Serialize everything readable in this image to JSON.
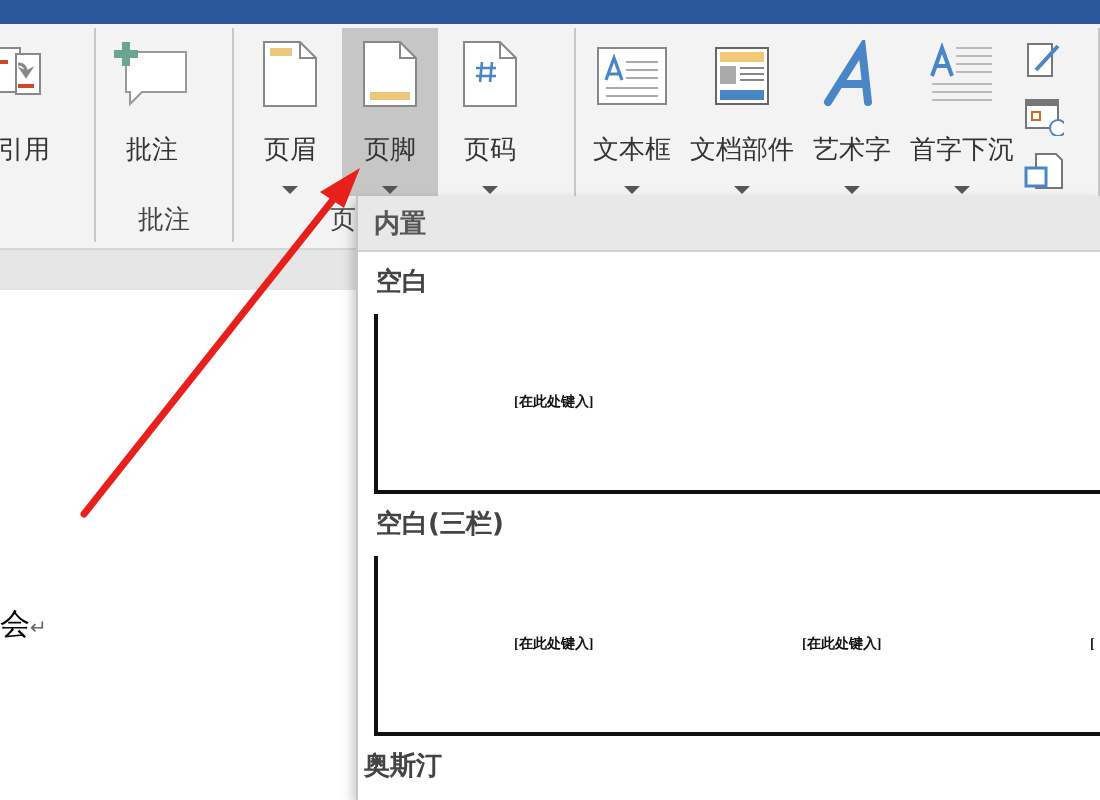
{
  "ribbon_groups": [
    {
      "buttons": [
        {
          "label": "引用",
          "selected": false
        }
      ]
    },
    {
      "label": "批注",
      "buttons": [
        {
          "label": "批注",
          "selected": false
        }
      ]
    },
    {
      "label": "页",
      "buttons": [
        {
          "label": "页眉",
          "has_menu": true,
          "selected": false
        },
        {
          "label": "页脚",
          "has_menu": true,
          "selected": true
        },
        {
          "label": "页码",
          "has_menu": true,
          "selected": false
        }
      ]
    },
    {
      "buttons": [
        {
          "label": "文本框",
          "has_menu": true,
          "selected": false
        },
        {
          "label": "文档部件",
          "has_menu": true,
          "selected": false
        },
        {
          "label": "艺术字",
          "has_menu": true,
          "selected": false
        },
        {
          "label": "首字下沉",
          "has_menu": true,
          "selected": false
        }
      ]
    }
  ],
  "document": {
    "text": "会",
    "mark": "↵"
  },
  "footer_menu": {
    "header": "内置",
    "sections": [
      {
        "title": "空白",
        "placeholders": [
          "[在此处键入]"
        ]
      },
      {
        "title": "空白(三栏)",
        "placeholders": [
          "[在此处键入]",
          "[在此处键入]",
          "["
        ]
      },
      {
        "title": "奥斯汀"
      }
    ]
  }
}
